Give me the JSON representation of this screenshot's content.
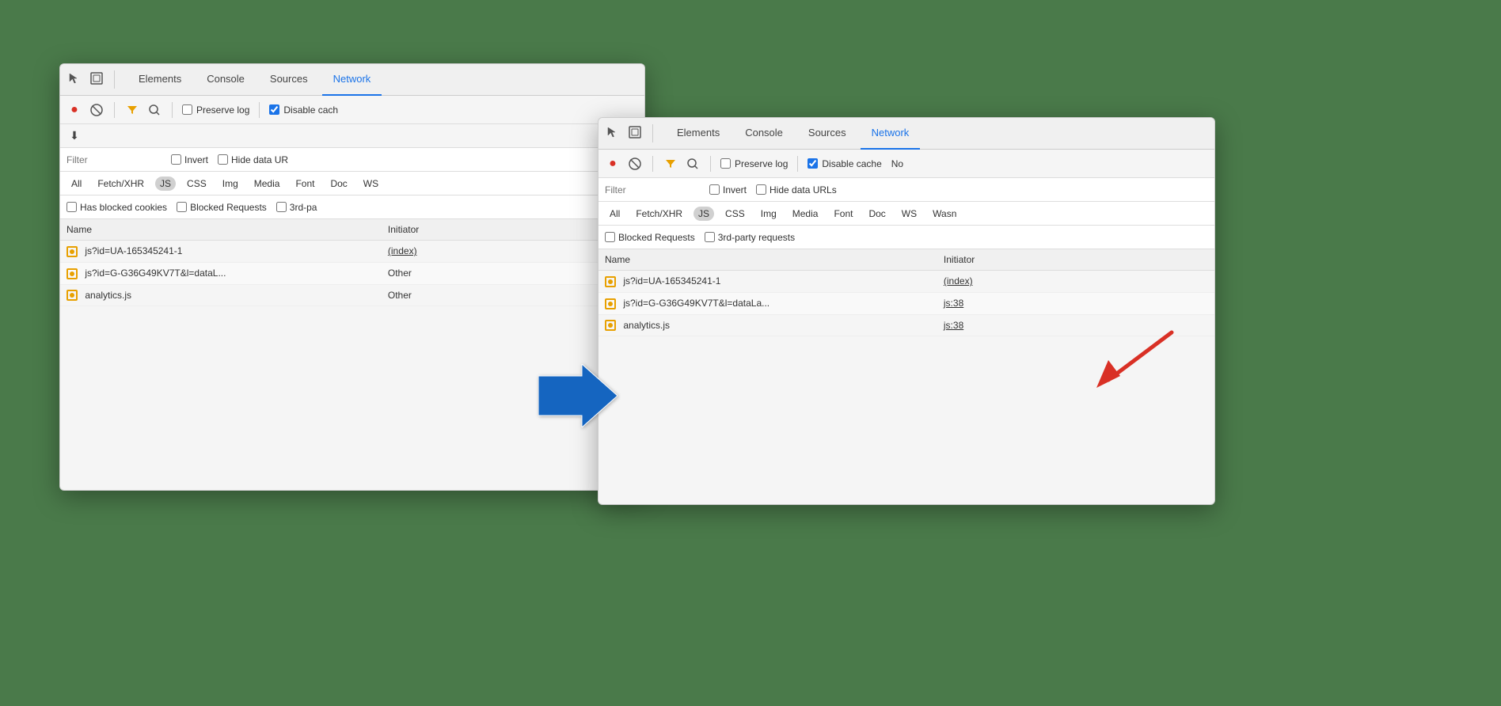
{
  "window1": {
    "tabs": [
      {
        "label": "Elements",
        "active": false
      },
      {
        "label": "Console",
        "active": false
      },
      {
        "label": "Sources",
        "active": false
      },
      {
        "label": "Network",
        "active": true
      }
    ],
    "toolbar": {
      "preserve_log_label": "Preserve log",
      "disable_cache_label": "Disable cach"
    },
    "filter_placeholder": "Filter",
    "filter_options": [
      "Invert",
      "Hide data UR"
    ],
    "type_filters": [
      "All",
      "Fetch/XHR",
      "JS",
      "CSS",
      "Img",
      "Media",
      "Font",
      "Doc",
      "WS"
    ],
    "extra_filters": [
      "Has blocked cookies",
      "Blocked Requests",
      "3rd-pa"
    ],
    "table_headers": [
      "Name",
      "Initiator"
    ],
    "rows": [
      {
        "name": "js?id=UA-165345241-1",
        "initiator": "(index)"
      },
      {
        "name": "js?id=G-G36G49KV7T&l=dataL...",
        "initiator": "Other"
      },
      {
        "name": "analytics.js",
        "initiator": "Other"
      }
    ]
  },
  "window2": {
    "tabs": [
      {
        "label": "Elements",
        "active": false
      },
      {
        "label": "Console",
        "active": false
      },
      {
        "label": "Sources",
        "active": false
      },
      {
        "label": "Network",
        "active": true
      }
    ],
    "toolbar": {
      "preserve_log_label": "Preserve log",
      "disable_cache_label": "Disable cache",
      "no_label": "No"
    },
    "filter_placeholder": "Filter",
    "filter_options": [
      "Invert",
      "Hide data URLs"
    ],
    "type_filters": [
      "All",
      "Fetch/XHR",
      "JS",
      "CSS",
      "Img",
      "Media",
      "Font",
      "Doc",
      "WS",
      "Wasn"
    ],
    "extra_filters": [
      "Blocked Requests",
      "3rd-party requests"
    ],
    "table_headers": [
      "Name",
      "Initiator"
    ],
    "rows": [
      {
        "name": "js?id=UA-165345241-1",
        "initiator": "(index)"
      },
      {
        "name": "js?id=G-G36G49KV7T&l=dataLa...",
        "initiator": "js:38"
      },
      {
        "name": "analytics.js",
        "initiator": "js:38"
      }
    ]
  },
  "icons": {
    "cursor": "↖",
    "inspect": "⧉",
    "record": "●",
    "stop": "⊘",
    "filter": "▼",
    "search": "🔍",
    "download": "⬇"
  }
}
